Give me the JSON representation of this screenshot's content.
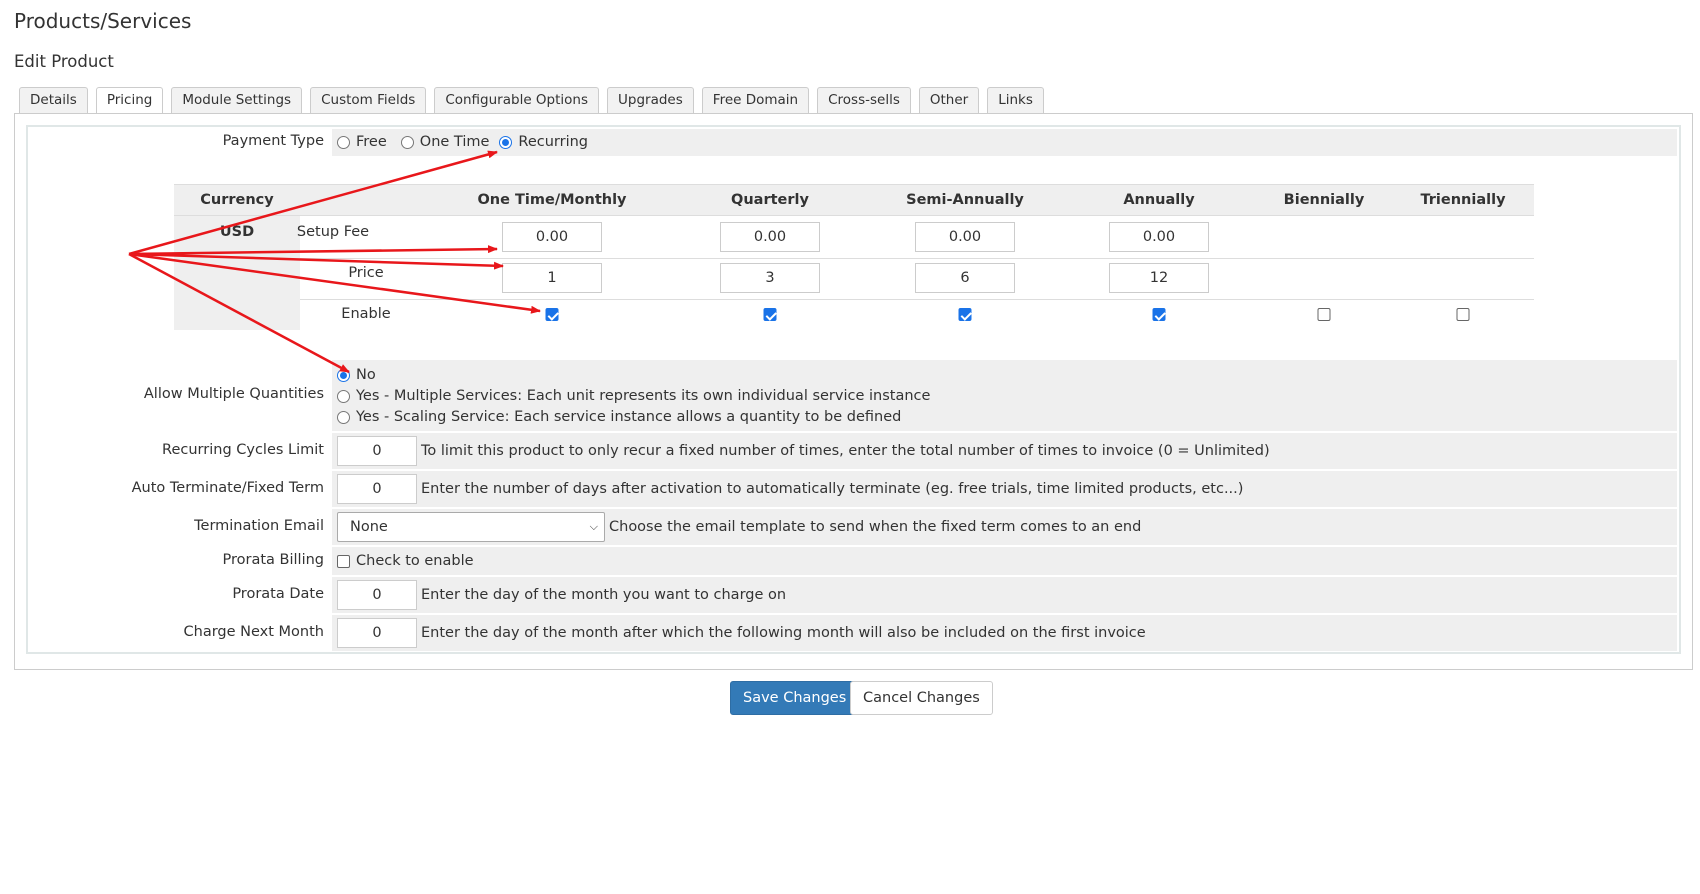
{
  "page": {
    "title": "Products/Services",
    "subtitle": "Edit Product"
  },
  "tabs": [
    "Details",
    "Pricing",
    "Module Settings",
    "Custom Fields",
    "Configurable Options",
    "Upgrades",
    "Free Domain",
    "Cross-sells",
    "Other",
    "Links"
  ],
  "active_tab": "Pricing",
  "payment_type": {
    "label": "Payment Type",
    "options": [
      "Free",
      "One Time",
      "Recurring"
    ],
    "selected": "Recurring"
  },
  "pricing_table": {
    "headers": {
      "currency": "Currency",
      "one_time_monthly": "One Time/Monthly",
      "quarterly": "Quarterly",
      "semi_annually": "Semi-Annually",
      "annually": "Annually",
      "biennially": "Biennially",
      "triennially": "Triennially"
    },
    "currency": "USD",
    "rows": {
      "setup_fee": "Setup Fee",
      "price": "Price",
      "enable": "Enable"
    },
    "setup_fee": {
      "monthly": "0.00",
      "quarterly": "0.00",
      "semi_annually": "0.00",
      "annually": "0.00"
    },
    "price": {
      "monthly": "1",
      "quarterly": "3",
      "semi_annually": "6",
      "annually": "12"
    },
    "enabled": {
      "monthly": true,
      "quarterly": true,
      "semi_annually": true,
      "annually": true,
      "biennially": false,
      "triennially": false
    }
  },
  "allow_multiple_quantities": {
    "label": "Allow Multiple Quantities",
    "options": [
      "No",
      "Yes - Multiple Services: Each unit represents its own individual service instance",
      "Yes - Scaling Service: Each service instance allows a quantity to be defined"
    ],
    "selected": "No"
  },
  "recurring_cycles_limit": {
    "label": "Recurring Cycles Limit",
    "value": "0",
    "help": "To limit this product to only recur a fixed number of times, enter the total number of times to invoice (0 = Unlimited)"
  },
  "auto_terminate": {
    "label": "Auto Terminate/Fixed Term",
    "value": "0",
    "help": "Enter the number of days after activation to automatically terminate (eg. free trials, time limited products, etc...)"
  },
  "termination_email": {
    "label": "Termination Email",
    "value": "None",
    "help": "Choose the email template to send when the fixed term comes to an end"
  },
  "prorata_billing": {
    "label": "Prorata Billing",
    "checkbox_label": "Check to enable",
    "checked": false
  },
  "prorata_date": {
    "label": "Prorata Date",
    "value": "0",
    "help": "Enter the day of the month you want to charge on"
  },
  "charge_next_month": {
    "label": "Charge Next Month",
    "value": "0",
    "help": "Enter the day of the month after which the following month will also be included on the first invoice"
  },
  "buttons": {
    "save": "Save Changes",
    "cancel": "Cancel Changes"
  },
  "colors": {
    "primary": "#337ab7",
    "annotation_arrow": "#e8171b",
    "radio_checked": "#1a73e8",
    "row_background": "#efefef"
  }
}
